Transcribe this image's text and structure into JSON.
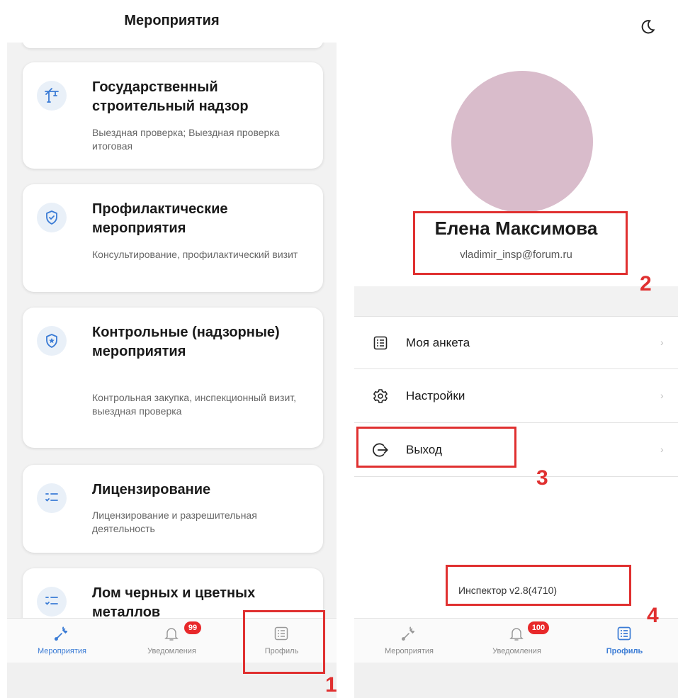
{
  "left": {
    "title": "Мероприятия",
    "cards": [
      {
        "icon": "crane-icon",
        "title": "Государственный строительный надзор",
        "subtitle": "Выездная проверка; Выездная проверка итоговая"
      },
      {
        "icon": "shield-check-icon",
        "title": "Профилактические мероприятия",
        "subtitle": "Консультирование, профилактический визит"
      },
      {
        "icon": "shield-star-icon",
        "title": "Контрольные (надзорные) мероприятия",
        "subtitle": "Контрольная закупка, инспекционный визит, выездная проверка"
      },
      {
        "icon": "checklist-icon",
        "title": "Лицензирование",
        "subtitle": "Лицензирование и разрешительная деятельность"
      },
      {
        "icon": "checklist-icon",
        "title": "Лом черных и цветных металлов",
        "subtitle": ""
      }
    ],
    "tabs": [
      {
        "label": "Мероприятия",
        "icon": "wrench-icon",
        "active": true
      },
      {
        "label": "Уведомления",
        "icon": "bell-icon",
        "badge": "99"
      },
      {
        "label": "Профиль",
        "icon": "list-icon"
      }
    ]
  },
  "right": {
    "name": "Елена Максимова",
    "email": "vladimir_insp@forum.ru",
    "menu": [
      {
        "icon": "list-icon",
        "label": "Моя анкета"
      },
      {
        "icon": "gear-icon",
        "label": "Настройки"
      },
      {
        "icon": "logout-icon",
        "label": "Выход"
      }
    ],
    "version": "Инспектор v2.8(4710)",
    "tabs": [
      {
        "label": "Мероприятия",
        "icon": "wrench-icon"
      },
      {
        "label": "Уведомления",
        "icon": "bell-icon",
        "badge": "100"
      },
      {
        "label": "Профиль",
        "icon": "list-icon",
        "active": true
      }
    ]
  },
  "annotations": [
    "1",
    "2",
    "3",
    "4"
  ],
  "colors": {
    "accent": "#3a7bd5",
    "annotation": "#e03030",
    "badge": "#e8282a",
    "avatar": "#d9bccb"
  }
}
